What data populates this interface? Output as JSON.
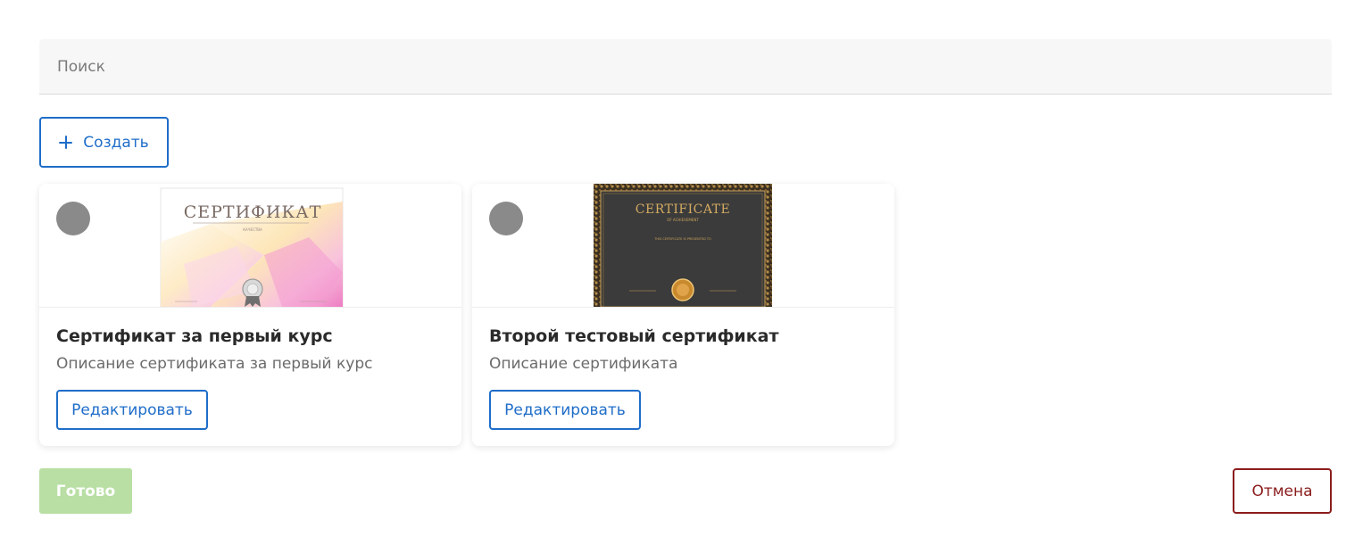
{
  "search": {
    "placeholder": "Поиск",
    "value": ""
  },
  "toolbar": {
    "create_label": "Создать",
    "create_icon": "plus-icon"
  },
  "cards": [
    {
      "title": "Сертификат за первый курс",
      "description": "Описание сертификата за первый курс",
      "edit_label": "Редактировать",
      "thumbnail": {
        "heading": "СЕРТИФИКАТ",
        "subheading": "КАЧЕСТВА",
        "style": "light-pink"
      }
    },
    {
      "title": "Второй тестовый сертификат",
      "description": "Описание сертификата",
      "edit_label": "Редактировать",
      "thumbnail": {
        "heading": "CERTIFICATE",
        "subheading": "OF ACHIEVEMENT",
        "body": "THIS CERTIFICATE IS PRESENTED TO",
        "style": "dark-gold"
      }
    }
  ],
  "footer": {
    "done_label": "Готово",
    "cancel_label": "Отмена"
  },
  "colors": {
    "accent": "#1f6dc9",
    "done_disabled": "#b9dfa4",
    "cancel": "#8b1c1c",
    "selector": "#8a8a8a"
  }
}
